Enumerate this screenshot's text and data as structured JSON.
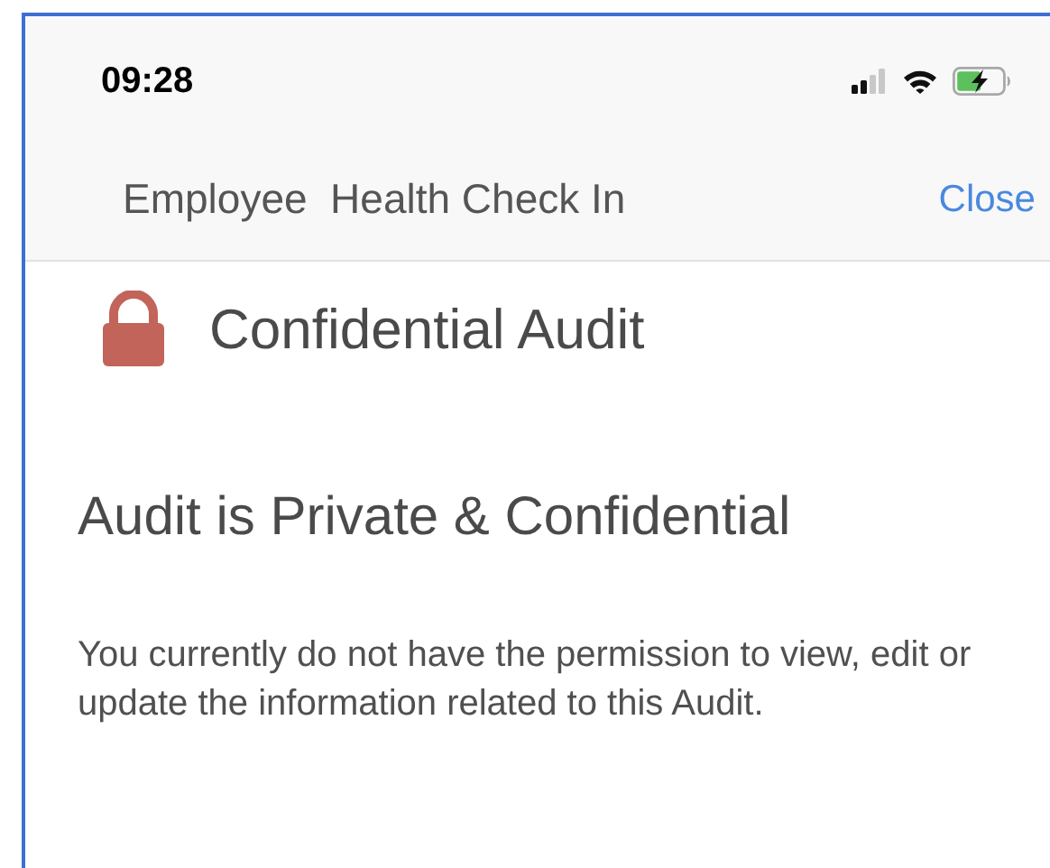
{
  "status_bar": {
    "time": "09:28"
  },
  "nav_bar": {
    "title": "Employee  Health Check In",
    "close": "Close"
  },
  "header": {
    "title": "Confidential Audit"
  },
  "notice": {
    "heading": "Audit is Private & Confidential",
    "message": "You currently do not have the permission to view, edit or update the information related to this Audit."
  }
}
